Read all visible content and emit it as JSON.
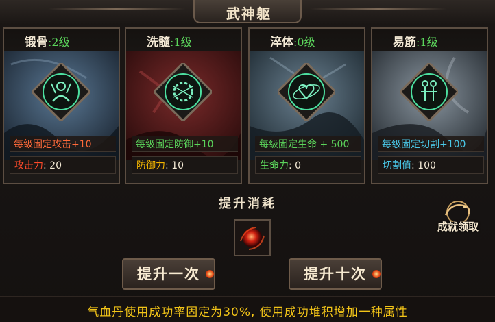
{
  "title": "武神躯",
  "panels": [
    {
      "name": "锻骨",
      "level": ":2级",
      "bonus": "每级固定攻击+10",
      "bonus_color": "#ff6a3a",
      "stat_label": "攻击力",
      "stat_value": ": 20",
      "stat_color": "#ff4a2a",
      "theme": "#3a5066",
      "icon": "warrior-icon"
    },
    {
      "name": "洗髓",
      "level": ":1级",
      "bonus": "每级固定防御+10",
      "bonus_color": "#5bd45b",
      "stat_label": "防御力",
      "stat_value": ": 10",
      "stat_color": "#f2b400",
      "theme": "#5a1a1a",
      "icon": "ring-icon"
    },
    {
      "name": "淬体",
      "level": ":0级",
      "bonus": "每级固定生命 + 500",
      "bonus_color": "#5bd45b",
      "stat_label": "生命力",
      "stat_value": ": 0",
      "stat_color": "#5bd45b",
      "theme": "#3a4e5a",
      "icon": "heart-orbit-icon"
    },
    {
      "name": "易筋",
      "level": ":1级",
      "bonus": "每级固定切割+100",
      "bonus_color": "#4ac8e8",
      "stat_label": "切割值",
      "stat_value": ": 100",
      "stat_color": "#4ac8e8",
      "theme": "#4a5660",
      "icon": "body-icon"
    }
  ],
  "cost_title": "提升消耗",
  "cost_item": "qixue-pill-icon",
  "buttons": {
    "upgrade_once": "提升一次",
    "upgrade_ten": "提升十次"
  },
  "achievement": "成就领取",
  "footer": "气血丹使用成功率固定为30%, 使用成功堆积增加一种属性",
  "colors": {
    "gold": "#f2c418",
    "level_green": "#5bd45b",
    "emblem_glow": "#4ce0a0"
  }
}
